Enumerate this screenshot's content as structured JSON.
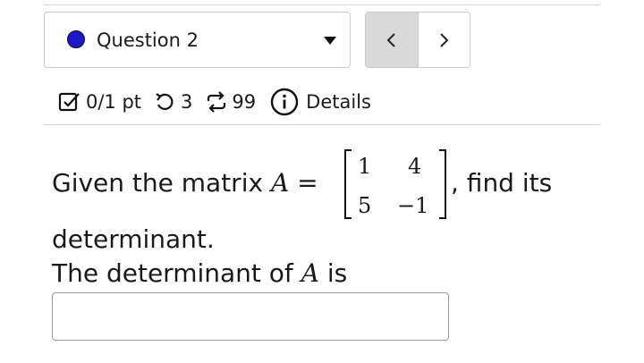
{
  "question_selector": {
    "label": "Question 2",
    "status_color": "#1a18c8",
    "caret_icon": "caret-down-icon"
  },
  "nav": {
    "prev_icon": "chevron-left-icon",
    "next_icon": "chevron-right-icon",
    "prev_glyph": "<",
    "next_glyph": ">"
  },
  "meta": {
    "score": "0/1 pt",
    "attempts": "3",
    "submissions": "99",
    "details_label": "Details"
  },
  "question": {
    "intro": "Given the matrix",
    "variable": "A",
    "equals": "=",
    "matrix": [
      [
        "1",
        "4"
      ],
      [
        "5",
        "−1"
      ]
    ],
    "after_matrix": ", find its",
    "line2": "determinant.",
    "prompt_before": "The determinant of",
    "prompt_variable": "A",
    "prompt_after": "is"
  },
  "answer": {
    "value": "",
    "placeholder": ""
  }
}
